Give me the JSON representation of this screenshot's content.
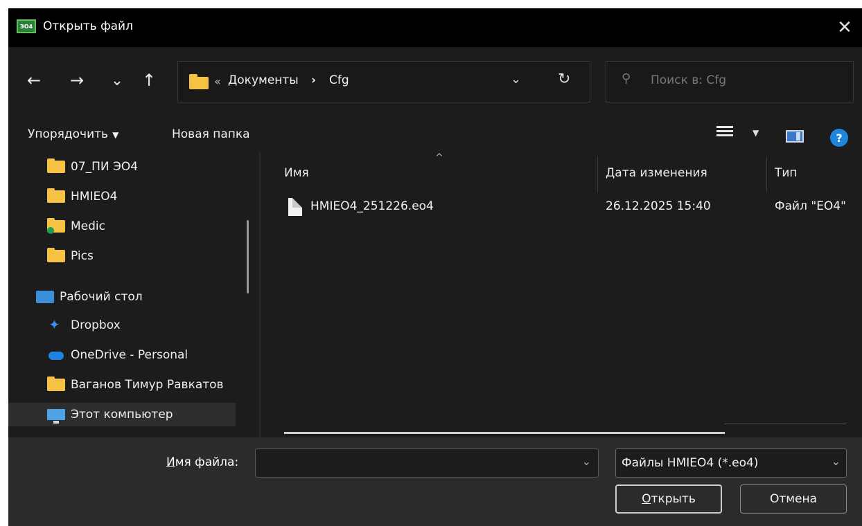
{
  "window": {
    "title": "Открыть файл",
    "app_icon_text": "ЭО4",
    "close_glyph": "✕"
  },
  "nav": {
    "back_glyph": "←",
    "forward_glyph": "→",
    "recent_glyph": "⌄",
    "up_glyph": "↑",
    "breadcrumb_overflow": "«",
    "breadcrumb": [
      "Документы",
      "Cfg"
    ],
    "breadcrumb_sep": "›",
    "dropdown_glyph": "⌄",
    "refresh_glyph": "↻",
    "search_glyph": "⚲",
    "search_placeholder": "Поиск в: Cfg"
  },
  "toolbar": {
    "organize_label": "Упорядочить",
    "organize_caret": "▼",
    "new_folder_label": "Новая папка",
    "view_caret": "▼",
    "help_glyph": "?"
  },
  "sidebar": {
    "items": [
      {
        "label": "07_ПИ ЭО4",
        "icon": "folder-icon"
      },
      {
        "label": "HMIEO4",
        "icon": "folder-icon"
      },
      {
        "label": "Medic",
        "icon": "folder-sync-icon"
      },
      {
        "label": "Pics",
        "icon": "folder-icon"
      },
      {
        "label": "Рабочий стол",
        "icon": "desktop-icon"
      },
      {
        "label": "Dropbox",
        "icon": "dropbox-icon"
      },
      {
        "label": "OneDrive - Personal",
        "icon": "onedrive-icon"
      },
      {
        "label": "Ваганов Тимур Равкатов",
        "icon": "folder-icon"
      },
      {
        "label": "Этот компьютер",
        "icon": "computer-icon"
      }
    ]
  },
  "filelist": {
    "columns": {
      "name": "Имя",
      "date": "Дата изменения",
      "type": "Тип"
    },
    "sort_glyph": "^",
    "rows": [
      {
        "name": "HMIEO4_251226.eo4",
        "date": "26.12.2025 15:40",
        "type": "Файл \"EO4\""
      }
    ]
  },
  "bottom": {
    "filename_label_access": "И",
    "filename_label_rest": "мя файла:",
    "filename_value": "",
    "filename_caret": "⌄",
    "filter_value": "Файлы HMIEO4 (*.eo4)",
    "filter_caret": "⌄",
    "open_access": "О",
    "open_rest": "ткрыть",
    "cancel_label": "Отмена"
  },
  "colors": {
    "background": "#1c1c1c",
    "titlebar": "#000000",
    "bottombar": "#2b2b2b",
    "folder": "#f5c243",
    "accent": "#1f86e0"
  }
}
